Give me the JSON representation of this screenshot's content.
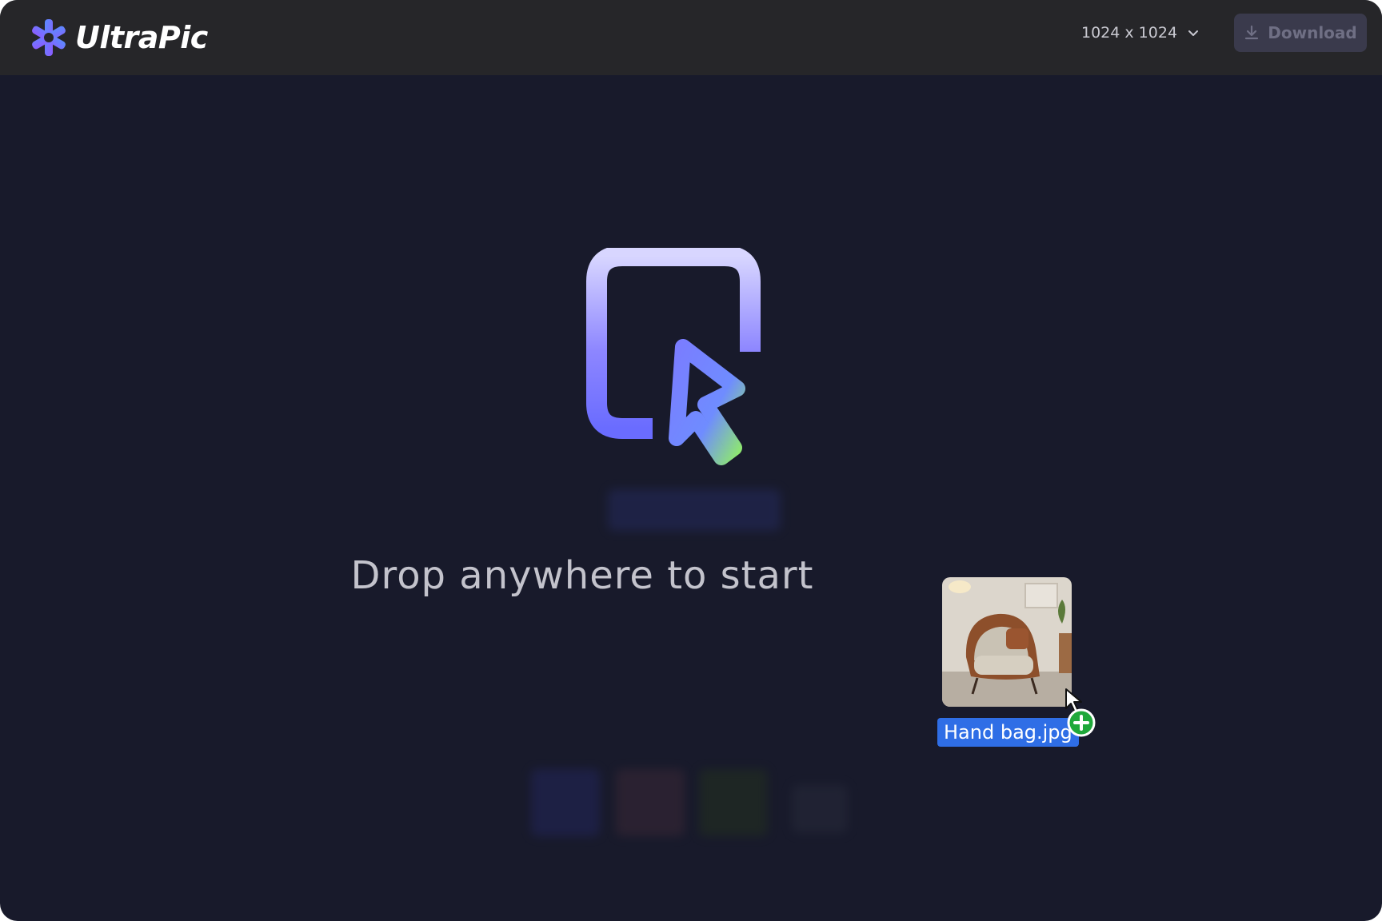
{
  "app": {
    "name": "UltraPic"
  },
  "toolbar": {
    "size_value": "1024 x 1024",
    "download_label": "Download"
  },
  "main": {
    "drop_prompt": "Drop anywhere to start"
  },
  "drag": {
    "file_name": "Hand bag.jpg"
  },
  "colors": {
    "background": "#181a2b",
    "topbar": "#262629",
    "accent_blue": "#2f6ee6",
    "badge_green": "#1fa83a"
  },
  "icons": {
    "logo": "snowflake-gear-icon",
    "dropdown": "chevron-down-icon",
    "download": "download-icon",
    "hero": "cursor-click-icon",
    "badge": "plus-icon",
    "pointer": "mouse-pointer-icon"
  }
}
